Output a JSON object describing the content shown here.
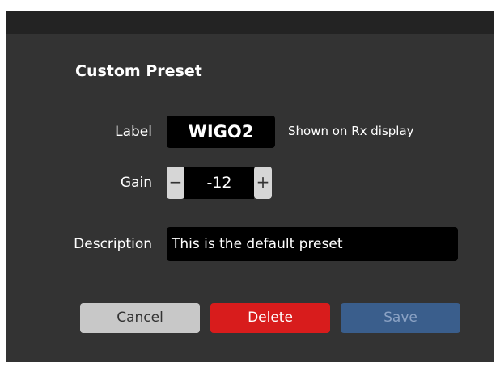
{
  "dialog": {
    "heading": "Custom Preset",
    "label_field": {
      "label": "Label",
      "value": "WIGO2",
      "hint": "Shown on Rx display"
    },
    "gain_field": {
      "label": "Gain",
      "decrement": "−",
      "value": "-12",
      "increment": "+"
    },
    "description_field": {
      "label": "Description",
      "value": "This is the default preset"
    },
    "buttons": {
      "cancel": "Cancel",
      "delete": "Delete",
      "save": "Save"
    },
    "colors": {
      "background": "#333333",
      "title_strip": "#232323",
      "field_bg": "#000000",
      "cancel_bg": "#c8c8c8",
      "delete_bg": "#d81c1c",
      "save_bg": "#3a5e8c",
      "save_text_disabled": "#8ba2c4"
    }
  }
}
